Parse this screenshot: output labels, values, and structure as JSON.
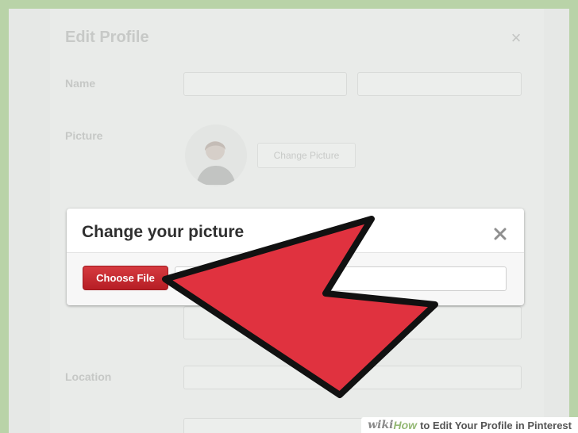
{
  "background_profile": {
    "title": "Edit Profile",
    "labels": {
      "name": "Name",
      "picture": "Picture",
      "location": "Location"
    },
    "change_picture_button": "Change Picture"
  },
  "modal": {
    "title": "Change your picture",
    "choose_file_label": "Choose File"
  },
  "watermark": {
    "prefix": "wiki",
    "how": "How",
    "article_title": "to Edit Your Profile in Pinterest"
  },
  "colors": {
    "frame": "#b9d3a8",
    "primary_button": "#c4252c",
    "arrow": "#e0323f"
  },
  "icons": {
    "edit_close": "close-icon",
    "modal_close": "close-icon"
  }
}
